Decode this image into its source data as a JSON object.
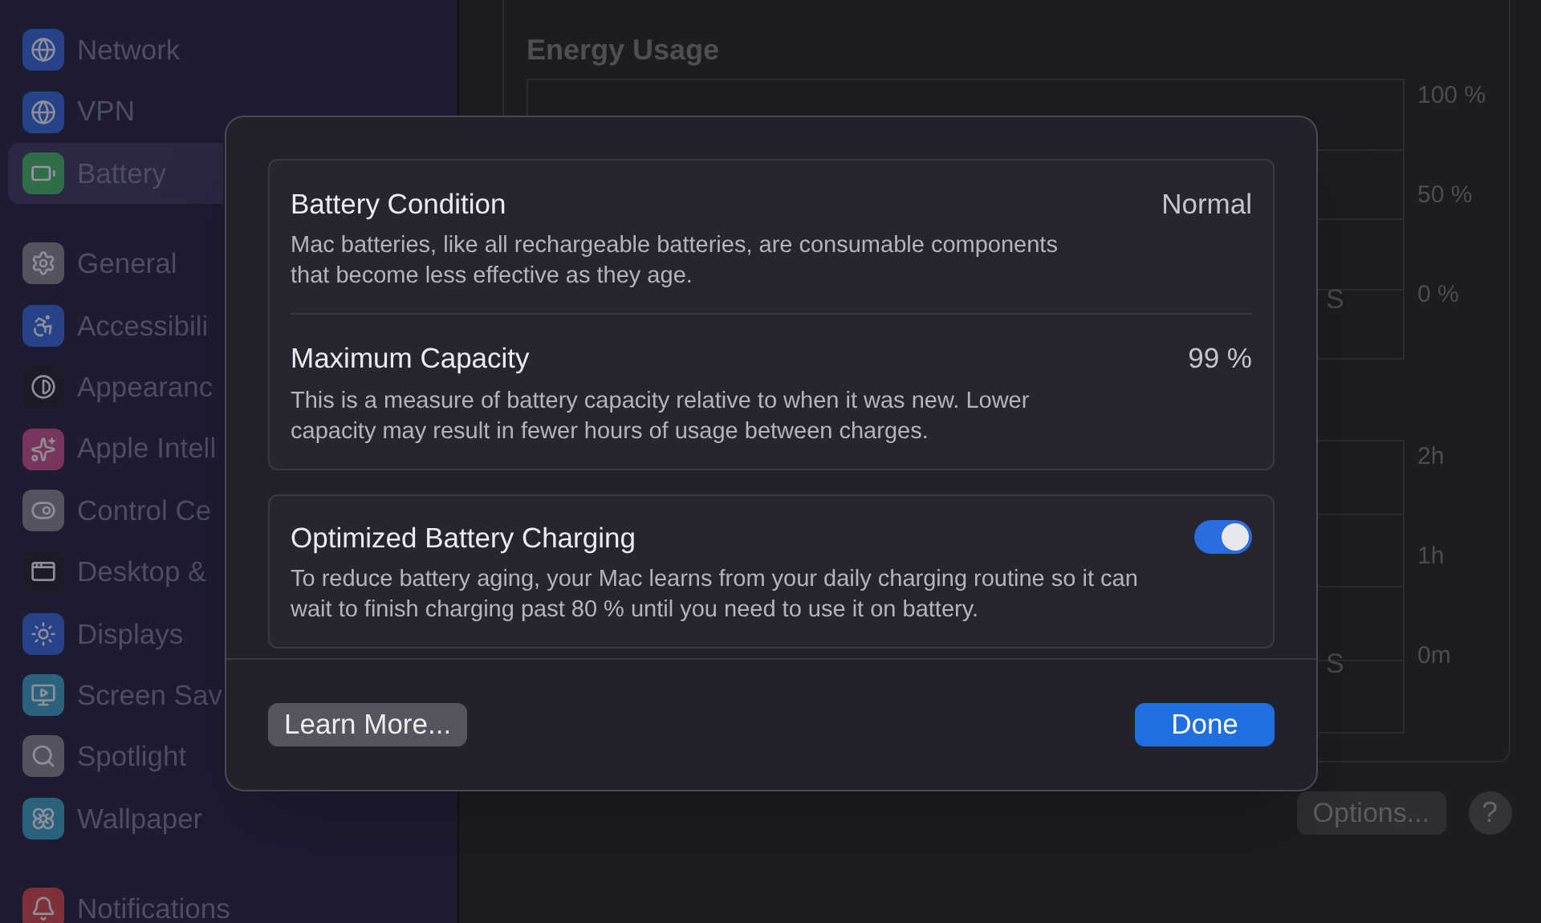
{
  "sidebar": {
    "sections": [
      {
        "items": [
          {
            "label": "Network",
            "selected": false
          },
          {
            "label": "VPN",
            "selected": false
          },
          {
            "label": "Battery",
            "selected": true
          }
        ]
      },
      {
        "items": [
          {
            "label": "General",
            "selected": false
          },
          {
            "label": "Accessibili",
            "selected": false
          },
          {
            "label": "Appearanc",
            "selected": false
          },
          {
            "label": "Apple Intell",
            "selected": false
          },
          {
            "label": "Control Ce",
            "selected": false
          },
          {
            "label": "Desktop &",
            "selected": false
          },
          {
            "label": "Displays",
            "selected": false
          },
          {
            "label": "Screen Sav",
            "selected": false
          },
          {
            "label": "Spotlight",
            "selected": false
          },
          {
            "label": "Wallpaper",
            "selected": false
          }
        ]
      },
      {
        "items": [
          {
            "label": "Notifications",
            "selected": false
          }
        ]
      }
    ]
  },
  "main": {
    "energy_usage": {
      "title": "Energy Usage",
      "y_labels": [
        "100 %",
        "50 %",
        "0 %"
      ],
      "x_fragment": "S"
    },
    "screen_time": {
      "y_labels": [
        "2h",
        "1h",
        "0m"
      ],
      "x_fragment": "S"
    },
    "options_button": "Options...",
    "help_button": "?"
  },
  "dialog": {
    "health_rows": [
      {
        "title": "Battery Condition",
        "value": "Normal",
        "description": "Mac batteries, like all rechargeable batteries, are consumable components that become less effective as they age."
      },
      {
        "title": "Maximum Capacity",
        "value": "99 %",
        "description": "This is a measure of battery capacity relative to when it was new. Lower capacity may result in fewer hours of usage between charges."
      }
    ],
    "charging": {
      "title": "Optimized Battery Charging",
      "description": "To reduce battery aging, your Mac learns from your daily charging routine so it can wait to finish charging past 80 % until you need to use it on battery.",
      "on": true
    },
    "buttons": [
      {
        "label": "Learn More...",
        "kind": "secondary"
      },
      {
        "label": "Done",
        "kind": "primary"
      }
    ]
  }
}
